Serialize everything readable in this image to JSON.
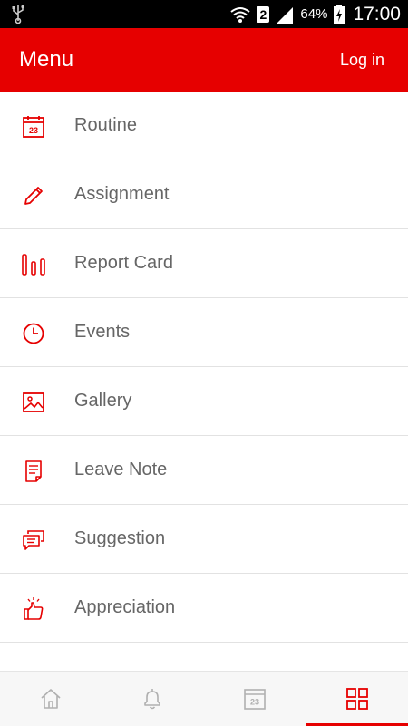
{
  "status": {
    "battery": "64%",
    "time": "17:00",
    "sim": "2"
  },
  "appbar": {
    "title": "Menu",
    "login": "Log in"
  },
  "menu": {
    "items": [
      {
        "label": "Routine",
        "icon": "calendar-icon",
        "badge": "23"
      },
      {
        "label": "Assignment",
        "icon": "pencil-icon"
      },
      {
        "label": "Report Card",
        "icon": "bar-chart-icon"
      },
      {
        "label": "Events",
        "icon": "clock-icon"
      },
      {
        "label": "Gallery",
        "icon": "image-icon"
      },
      {
        "label": "Leave Note",
        "icon": "note-icon"
      },
      {
        "label": "Suggestion",
        "icon": "chat-icon"
      },
      {
        "label": "Appreciation",
        "icon": "thumbs-up-icon"
      }
    ]
  },
  "bottom_nav": {
    "tabs": [
      {
        "icon": "home-icon",
        "active": false
      },
      {
        "icon": "bell-icon",
        "active": false
      },
      {
        "icon": "calendar-icon",
        "badge": "23",
        "active": false
      },
      {
        "icon": "grid-icon",
        "active": true
      }
    ]
  },
  "colors": {
    "accent": "#e60000",
    "label": "#666666",
    "icon_inactive": "#b0b0b0"
  }
}
